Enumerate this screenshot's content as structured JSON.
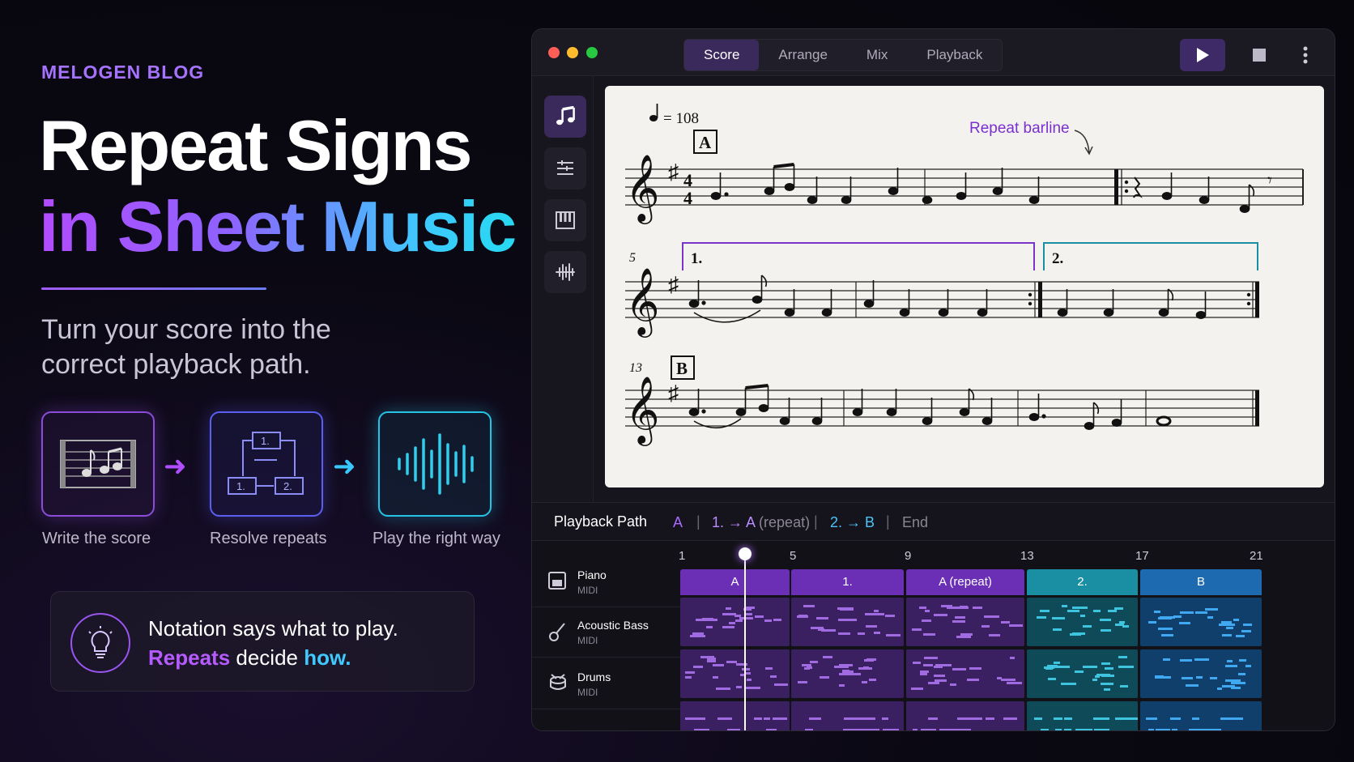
{
  "blog": {
    "tag": "MELOGEN BLOG"
  },
  "hero": {
    "title_line1": "Repeat Signs",
    "title_line2": "in Sheet Music",
    "subtitle": "Turn your score into the correct playback path."
  },
  "steps": [
    {
      "label": "Write the score",
      "icon": "score-icon"
    },
    {
      "label": "Resolve repeats",
      "icon": "flowchart-icon"
    },
    {
      "label": "Play the right way",
      "icon": "waveform-icon"
    }
  ],
  "tip": {
    "line1": "Notation says what to play.",
    "word_repeats": "Repeats",
    "word_decide": " decide ",
    "word_how": "how."
  },
  "window": {
    "tabs": [
      "Score",
      "Arrange",
      "Mix",
      "Playback"
    ],
    "active_tab": "Score"
  },
  "score": {
    "tempo": "= 108",
    "rehearsal_a": "A",
    "rehearsal_b": "B",
    "annotation": "Repeat barline",
    "measure_5": "5",
    "measure_13": "13",
    "ending_1": "1.",
    "ending_2": "2.",
    "time_sig_top": "4",
    "time_sig_bottom": "4"
  },
  "playback_path": {
    "title": "Playback Path",
    "a": "A",
    "first_part": "1. → A",
    "first_repeat": " (repeat)",
    "second": "2. → B",
    "end": "End"
  },
  "timeline": {
    "ticks": [
      "1",
      "5",
      "9",
      "13",
      "17",
      "21"
    ],
    "segments": [
      "A",
      "1.",
      "A (repeat)",
      "2.",
      "B"
    ],
    "tracks": [
      {
        "name": "Piano",
        "type": "MIDI",
        "icon": "piano-icon"
      },
      {
        "name": "Acoustic Bass",
        "type": "MIDI",
        "icon": "guitar-icon"
      },
      {
        "name": "Drums",
        "type": "MIDI",
        "icon": "drum-icon"
      }
    ],
    "playhead_measure": 3
  },
  "colors": {
    "purple": "#7a35c8",
    "teal": "#1a8fa3",
    "blue": "#1e6ab0"
  }
}
